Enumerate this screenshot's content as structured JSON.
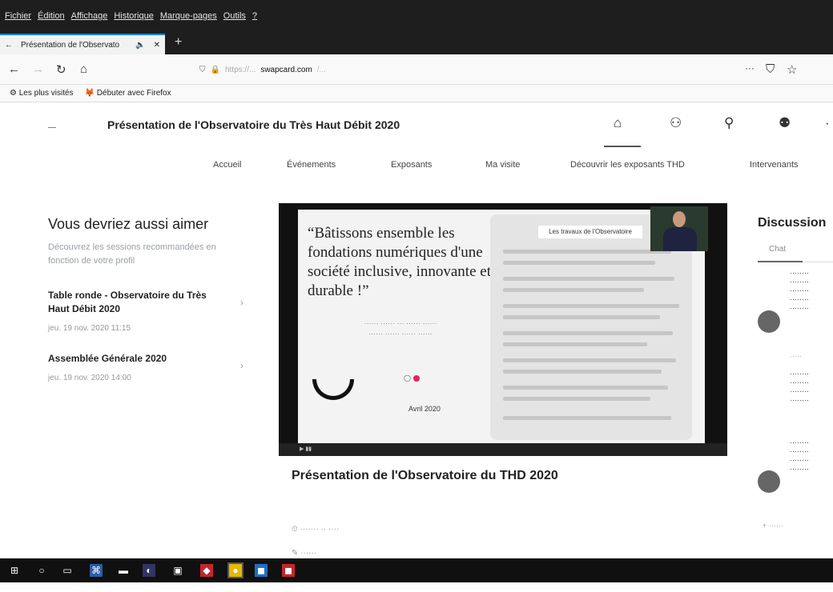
{
  "os_menu": {
    "items": [
      "Fichier",
      "Édition",
      "Affichage",
      "Historique",
      "Marque-pages",
      "Outils",
      "?"
    ]
  },
  "browser": {
    "tab_title": "Présentation de l'Observato",
    "url_domain": "swapcard.com",
    "bookmarks": [
      "Les plus visités",
      "Débuter avec Firefox"
    ]
  },
  "page": {
    "title": "Présentation de l'Observatoire du Très Haut Débit 2020",
    "nav": [
      "Accueil",
      "Événements",
      "Exposants",
      "Ma visite",
      "Découvrir les exposants THD",
      "Intervenants"
    ]
  },
  "sidebar": {
    "heading": "Vous devriez aussi aimer",
    "description": "Découvrez les sessions recommandées en fonction de votre profil",
    "sessions": [
      {
        "title": "Table ronde - Observatoire du Très Haut Débit 2020",
        "date": "jeu. 19 nov. 2020 11:15"
      },
      {
        "title": "Assemblée Générale 2020",
        "date": "jeu. 19 nov. 2020 14:00"
      }
    ]
  },
  "video": {
    "quote": "Bâtissons ensemble les fondations numériques d'une société inclusive, innovante et durable !",
    "panel_header": "Les travaux de l'Observatoire",
    "date": "Avril 2020"
  },
  "session": {
    "title": "Présentation de l'Observatoire du THD 2020"
  },
  "discussion": {
    "heading": "Discussion",
    "tab": "Chat"
  }
}
